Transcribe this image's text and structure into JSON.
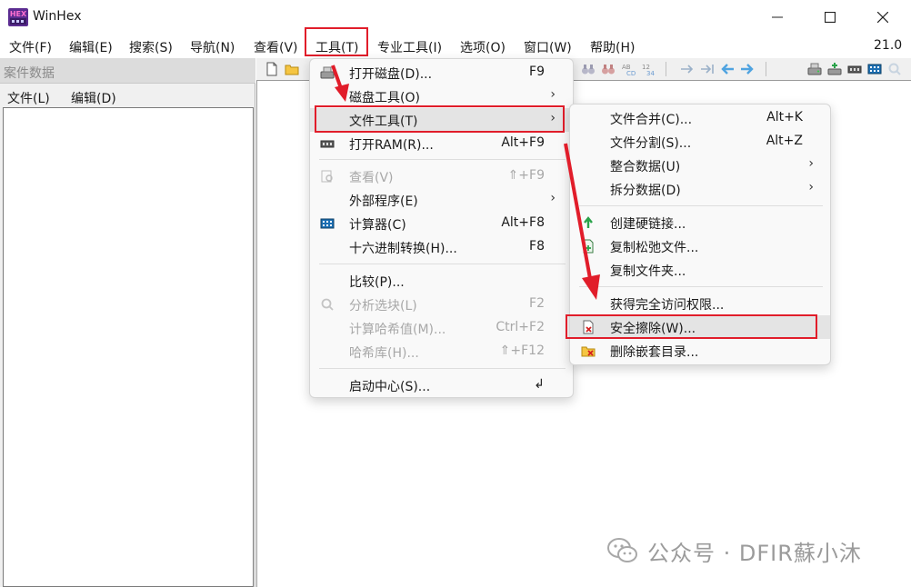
{
  "window": {
    "title": "WinHex",
    "version": "21.0"
  },
  "menubar": {
    "items": [
      "文件(F)",
      "编辑(E)",
      "搜索(S)",
      "导航(N)",
      "查看(V)",
      "工具(T)",
      "专业工具(I)",
      "选项(O)",
      "窗口(W)",
      "帮助(H)"
    ]
  },
  "case_pane": {
    "title": "案件数据",
    "menu_file": "文件(L)",
    "menu_edit": "编辑(D)"
  },
  "tools_menu": {
    "open_disk": {
      "label": "打开磁盘(D)...",
      "shortcut": "F9"
    },
    "disk_tools": {
      "label": "磁盘工具(O)"
    },
    "file_tools": {
      "label": "文件工具(T)"
    },
    "open_ram": {
      "label": "打开RAM(R)...",
      "shortcut": "Alt+F9"
    },
    "view": {
      "label": "查看(V)",
      "shortcut": "⇑+F9"
    },
    "external": {
      "label": "外部程序(E)"
    },
    "calculator": {
      "label": "计算器(C)",
      "shortcut": "Alt+F8"
    },
    "hex_convert": {
      "label": "十六进制转换(H)...",
      "shortcut": "F8"
    },
    "compare": {
      "label": "比较(P)..."
    },
    "analyze": {
      "label": "分析选块(L)",
      "shortcut": "F2"
    },
    "hash": {
      "label": "计算哈希值(M)...",
      "shortcut": "Ctrl+F2"
    },
    "hash_db": {
      "label": "哈希库(H)...",
      "shortcut": "⇑+F12"
    },
    "start_center": {
      "label": "启动中心(S)...",
      "shortcut": "↲"
    },
    "submenu_chevron": "›"
  },
  "file_tools_menu": {
    "merge": {
      "label": "文件合并(C)...",
      "shortcut": "Alt+K"
    },
    "split": {
      "label": "文件分割(S)...",
      "shortcut": "Alt+Z"
    },
    "unify": {
      "label": "整合数据(U)"
    },
    "dissect": {
      "label": "拆分数据(D)"
    },
    "hardlink": {
      "label": "创建硬链接..."
    },
    "copy_slack": {
      "label": "复制松弛文件..."
    },
    "copy_folder": {
      "label": "复制文件夹..."
    },
    "full_access": {
      "label": "获得完全访问权限..."
    },
    "secure_erase": {
      "label": "安全擦除(W)..."
    },
    "delete_nested": {
      "label": "删除嵌套目录..."
    }
  },
  "watermark": {
    "text": "公众号 · DFIR蘇小沐"
  },
  "colors": {
    "highlight_red": "#e11d2a",
    "menu_bg": "#f9f9f9",
    "hover_bg": "#e4e4e4",
    "disabled_text": "#a8a8a8"
  }
}
